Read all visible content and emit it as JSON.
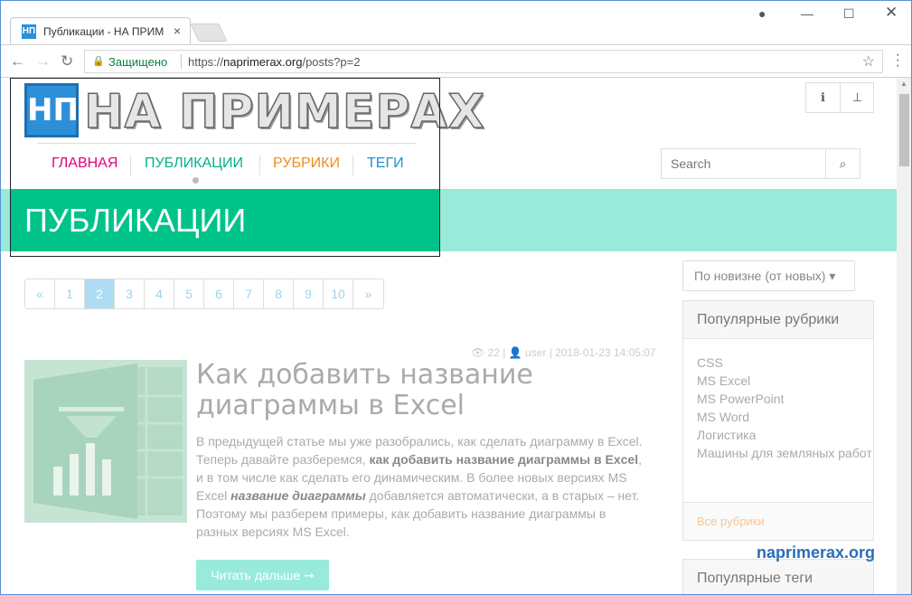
{
  "browser": {
    "tab_title": "Публикации - НА ПРИМ",
    "tab_favicon": "НП",
    "secure_label": "Защищено",
    "url_prefix": "https://",
    "url_host": "naprimerax.org",
    "url_path": "/posts?p=2"
  },
  "header": {
    "logo_badge": "НП",
    "logo_text": "НА ПРИМЕРАХ",
    "nav": [
      {
        "label": "ГЛАВНАЯ",
        "color": "#e5007d"
      },
      {
        "label": "ПУБЛИКАЦИИ",
        "color": "#00b386"
      },
      {
        "label": "РУБРИКИ",
        "color": "#f08c1e"
      },
      {
        "label": "ТЕГИ",
        "color": "#1e8fd6"
      }
    ],
    "search_placeholder": "Search",
    "banner_title": "ПУБЛИКАЦИИ"
  },
  "pagination": [
    "«",
    "1",
    "2",
    "3",
    "4",
    "5",
    "6",
    "7",
    "8",
    "9",
    "10",
    "»"
  ],
  "pagination_active": "2",
  "post": {
    "views": "22",
    "author": "user",
    "date": "2018-01-23 14:05:07",
    "title": "Как добавить название диаграммы в Excel",
    "excerpt_1": "В предыдущей статье мы уже разобрались, как сделать диаграмму в Excel. Теперь давайте разберемся, ",
    "excerpt_bold": "как добавить название диаграммы в Excel",
    "excerpt_2": ", и в том числе как сделать его динамическим. В более новых версиях MS Excel ",
    "excerpt_em": "название диаграммы",
    "excerpt_3": " добавляется автоматически, а в старых – нет. Поэтому мы разберем примеры, как добавить название диаграммы в разных версиях MS Excel.",
    "read_more": "Читать дальше ➞"
  },
  "sidebar": {
    "sort_label": "По новизне (от новых) ▾",
    "popular_categories_title": "Популярные рубрики",
    "categories": [
      "CSS",
      "MS Excel",
      "MS PowerPoint",
      "MS Word",
      "Логистика",
      "Машины для земляных работ"
    ],
    "all_categories": "Все рубрики",
    "popular_tags_title": "Популярные теги"
  },
  "watermark": "naprimerax.org"
}
